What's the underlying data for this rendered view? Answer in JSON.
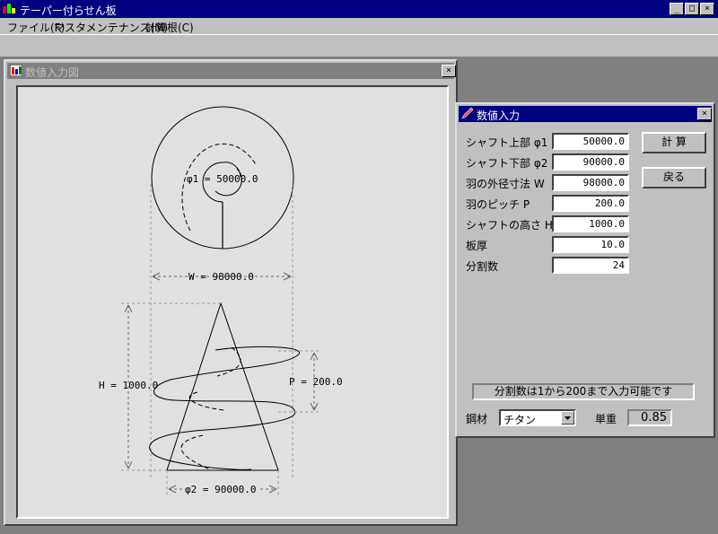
{
  "app": {
    "title": "テーパー付らせん板",
    "window_buttons": [
      "_",
      "□",
      "×"
    ]
  },
  "menu": [
    "ファイル(F)",
    "マスタメンテナンス(M)",
    "計算根(C)"
  ],
  "drawing_window": {
    "title": "数値入力図",
    "labels": {
      "phi1": "φ1 = 50000.0",
      "w": "W = 98000.0",
      "h": "H = 1000.0",
      "p": "P = 200.0",
      "phi2": "φ2 = 90000.0"
    }
  },
  "dialog": {
    "title": "数値入力",
    "fields": [
      {
        "label": "シャフト上部 φ1",
        "value": "50000.0"
      },
      {
        "label": "シャフト下部 φ2",
        "value": "90000.0"
      },
      {
        "label": "羽の外径寸法 W",
        "value": "98000.0"
      },
      {
        "label": "羽のピッチ P",
        "value": "200.0"
      },
      {
        "label": "シャフトの高さ H",
        "value": "1000.0"
      },
      {
        "label": "板厚",
        "value": "10.0"
      },
      {
        "label": "分割数",
        "value": "24"
      }
    ],
    "calc_button": "計 算",
    "back_button": "戻る",
    "status_message": "分割数は1から200まで入力可能です",
    "material_label": "鋼材",
    "material_value": "チタン",
    "unit_weight_label": "単重",
    "unit_weight_value": "0.85"
  }
}
